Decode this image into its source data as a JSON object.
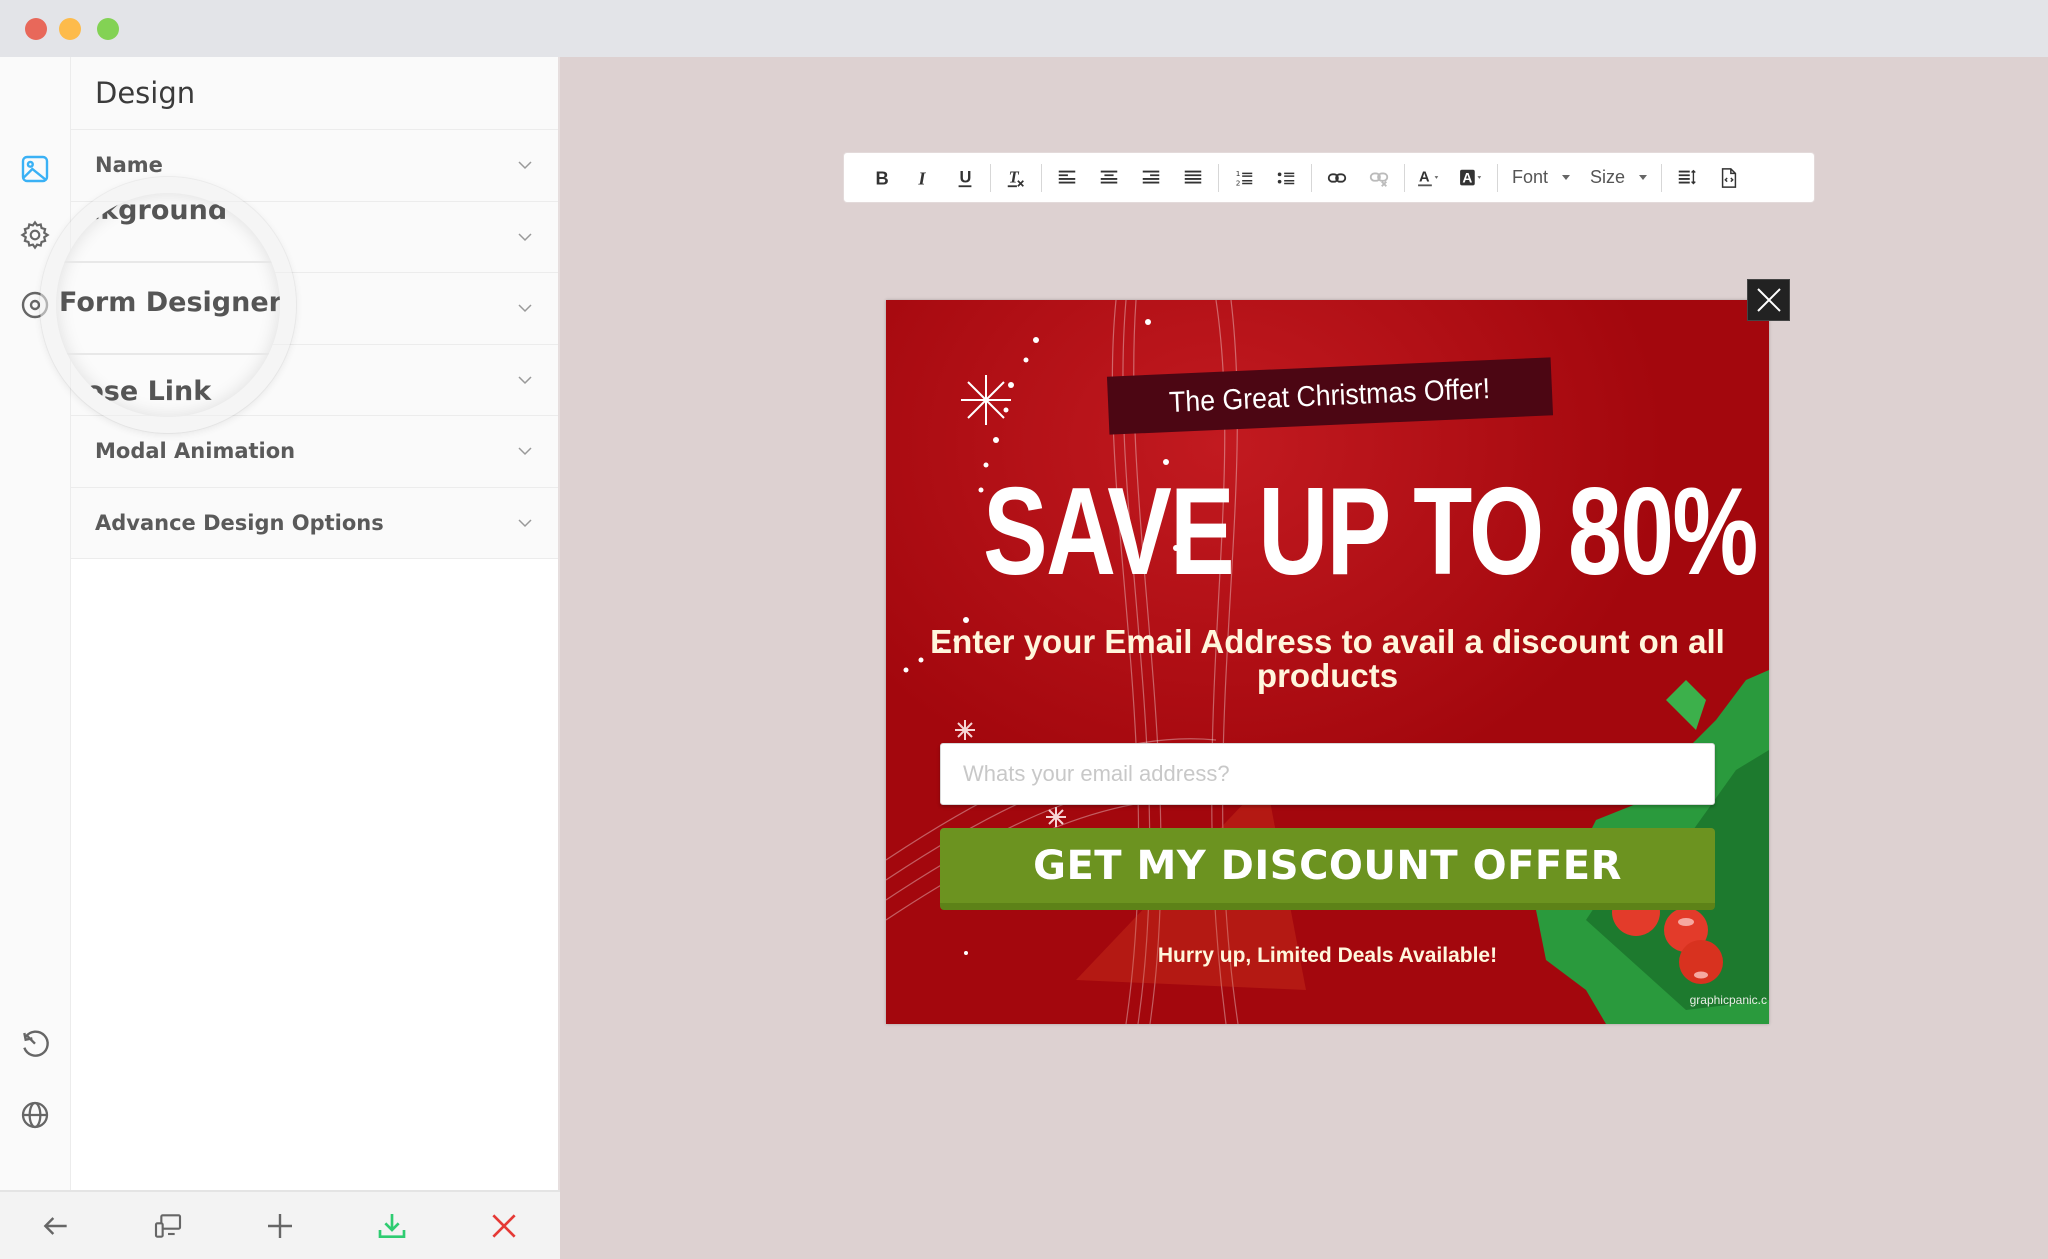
{
  "window": {
    "traffic_lights": [
      "close",
      "minimize",
      "maximize"
    ]
  },
  "rail": {
    "top_icons": [
      {
        "name": "image-icon",
        "active": true,
        "color": "#3ab1f5"
      },
      {
        "name": "gear-icon",
        "active": false
      },
      {
        "name": "target-icon",
        "active": false
      }
    ],
    "bottom_icons": [
      {
        "name": "history-icon"
      },
      {
        "name": "globe-icon"
      }
    ]
  },
  "panel": {
    "title": "Design",
    "sections": [
      {
        "label": "Name"
      },
      {
        "label": "Background"
      },
      {
        "label": "Form Designer"
      },
      {
        "label": "Close Link"
      },
      {
        "label": "Modal Animation"
      },
      {
        "label": "Advance Design Options"
      }
    ],
    "magnifier": {
      "visible_labels": [
        "ackground",
        "Form Designer",
        "lose Link"
      ]
    }
  },
  "bottombar": {
    "buttons": [
      {
        "name": "back-button",
        "icon": "arrow-left-icon"
      },
      {
        "name": "responsive-preview-button",
        "icon": "devices-icon"
      },
      {
        "name": "add-button",
        "icon": "plus-icon"
      },
      {
        "name": "download-button",
        "icon": "download-icon",
        "color": "#2ecc71"
      },
      {
        "name": "close-button",
        "icon": "x-icon",
        "color": "#e53935"
      }
    ]
  },
  "toolbar": {
    "buttons": [
      "Bold",
      "Italic",
      "Underline",
      "Remove Format",
      "Align Left",
      "Align Center",
      "Align Right",
      "Justify",
      "Numbered List",
      "Bulleted List",
      "Link",
      "Unlink",
      "Text Color",
      "Background Color",
      "Font",
      "Size",
      "Line Height",
      "Source"
    ],
    "font_label": "Font",
    "size_label": "Size"
  },
  "popup": {
    "banner": "The Great Christmas Offer!",
    "headline": "SAVE UP TO 80%",
    "subtext": "Enter your Email Address to avail a discount on all products",
    "email_placeholder": "Whats your email address?",
    "email_value": "",
    "cta": "GET MY DISCOUNT OFFER",
    "footer": "Hurry up, Limited Deals Available!",
    "credit": "graphicpanic.c",
    "colors": {
      "background": "#a3070d",
      "banner": "#4c0613",
      "cta": "#6c9320",
      "text_cream": "#fff6dc"
    }
  }
}
